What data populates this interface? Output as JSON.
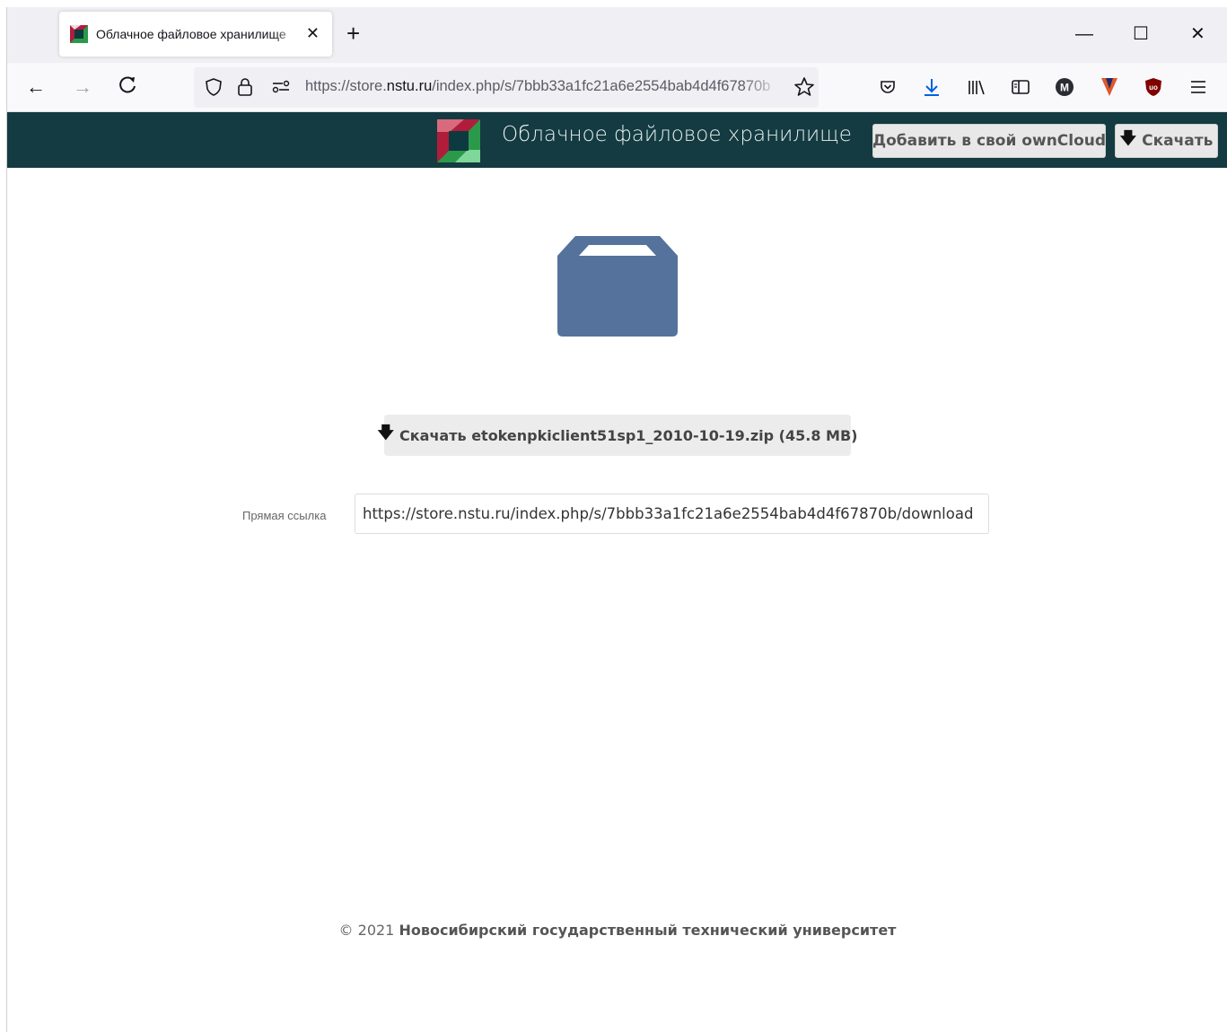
{
  "browser": {
    "tab": {
      "title": "Облачное файловое хранилище",
      "close_glyph": "✕"
    },
    "new_tab_glyph": "+",
    "window_controls": {
      "minimize": "—",
      "maximize": "☐",
      "close": "✕"
    },
    "nav": {
      "back": "←",
      "forward": "→",
      "reload": "C"
    },
    "url": {
      "prefix": "https://store.",
      "domain": "nstu.ru",
      "rest": "/index.php/s/7bbb33a1fc21a6e2554bab4d4f67870b"
    },
    "toolbar_icons": [
      "pocket-icon",
      "download-icon",
      "library-icon",
      "sidebar-icon",
      "account-icon",
      "extension-v-icon",
      "ublock-icon",
      "menu-icon"
    ]
  },
  "header": {
    "title": "Облачное файловое хранилище",
    "add_to_owncloud": "Добавить в свой ownCloud",
    "download": "Скачать"
  },
  "main": {
    "download_button": "Скачать etokenpkiclient51sp1_2010-10-19.zip (45.8 MB)",
    "direct_link_label": "Прямая ссылка",
    "direct_link_value": "https://store.nstu.ru/index.php/s/7bbb33a1fc21a6e2554bab4d4f67870b/download"
  },
  "footer": {
    "copyright": "© 2021",
    "org": "Новосибирский государственный технический университет"
  },
  "colors": {
    "header_bg": "#133b41",
    "folder": "#55729c",
    "download_accent": "#0060df"
  }
}
